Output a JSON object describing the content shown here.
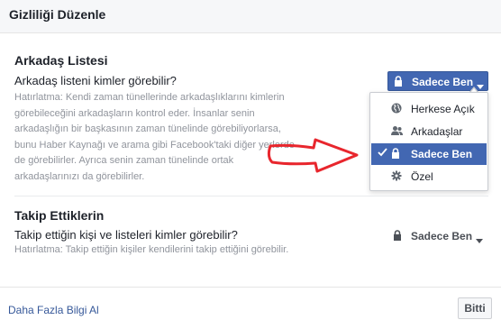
{
  "dialog": {
    "title": "Gizliliği Düzenle"
  },
  "friend_list": {
    "heading": "Arkadaş Listesi",
    "question": "Arkadaş listeni kimler görebilir?",
    "hint_lines": [
      "Hatırlatma: Kendi zaman tünellerinde arkadaşlıklarını kimlerin",
      "görebileceğini arkadaşların kontrol eder. İnsanlar senin",
      "arkadaşlığın bir başkasının zaman tünelinde görebiliyorlarsa,",
      "bunu Haber Kaynağı ve arama gibi Facebook'taki diğer yerlerde",
      "de görebilirler. Ayrıca senin zaman tünelinde ortak",
      "arkadaşlarınızı da görebilirler."
    ],
    "privacy_button_label": "Sadece Ben"
  },
  "audience_menu": {
    "items": [
      {
        "label": "Herkese Açık",
        "icon": "globe-icon",
        "selected": false
      },
      {
        "label": "Arkadaşlar",
        "icon": "friends-icon",
        "selected": false
      },
      {
        "label": "Sadece Ben",
        "icon": "lock-icon",
        "selected": true
      },
      {
        "label": "Özel",
        "icon": "gear-icon",
        "selected": false
      }
    ]
  },
  "followers": {
    "heading": "Takip Ettiklerin",
    "question": "Takip ettiğin kişi ve listeleri kimler görebilir?",
    "hint": "Hatırlatma: Takip ettiğin kişiler kendilerini takip ettiğini görebilir.",
    "privacy_button_label": "Sadece Ben"
  },
  "footer": {
    "learn_more": "Daha Fazla Bilgi Al",
    "done_button": "Bitti"
  },
  "colors": {
    "accent": "#4267b2",
    "annotation_arrow": "#e8262d",
    "link": "#365899"
  }
}
